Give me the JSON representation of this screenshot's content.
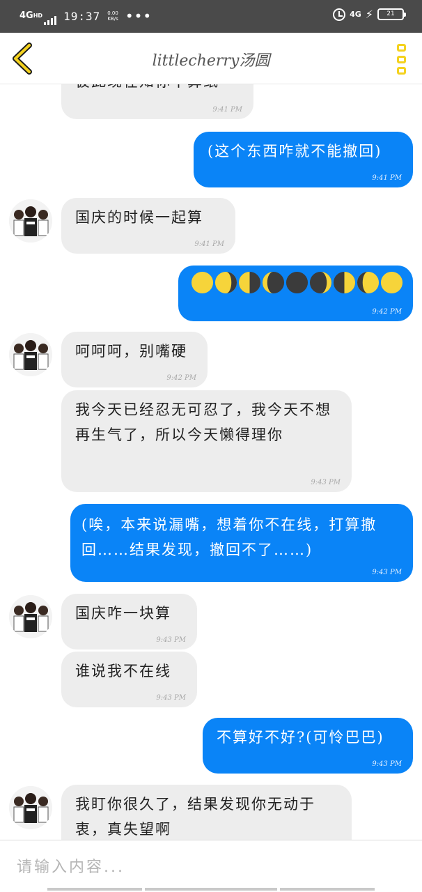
{
  "status_bar": {
    "network": "4G",
    "network_sup": "HD",
    "time": "19:37",
    "speed": "0.00\nKB/s",
    "dots": "•••",
    "right_network": "4G",
    "battery": "21"
  },
  "header": {
    "title": "littlecherry汤圆"
  },
  "messages": [
    {
      "text": "彼此现在知你不算纸",
      "time": "9:41 PM"
    },
    {
      "text": "(这个东西咋就不能撤回)",
      "time": "9:41 PM"
    },
    {
      "text": "国庆的时候一起算",
      "time": "9:41 PM"
    },
    {
      "text": "",
      "time": "9:42 PM"
    },
    {
      "text": "呵呵呵，别嘴硬",
      "time": "9:42 PM"
    },
    {
      "text": "我今天已经忍无可忍了，我今天不想再生气了，所以今天懒得理你",
      "time": "9:43 PM"
    },
    {
      "text": "(唉，本来说漏嘴，想着你不在线，打算撤回……结果发现，撤回不了……)",
      "time": "9:43 PM"
    },
    {
      "text": "国庆咋一块算",
      "time": "9:43 PM"
    },
    {
      "text": "谁说我不在线",
      "time": "9:43 PM"
    },
    {
      "text": "不算好不好?(可怜巴巴)",
      "time": "9:43 PM"
    },
    {
      "text": "我盯你很久了，结果发现你无动于衷，真失望啊",
      "time": ""
    }
  ],
  "moon_phases": [
    "full-moon",
    "waning-gibbous",
    "last-quarter",
    "waning-crescent",
    "new-moon",
    "waxing-crescent",
    "first-quarter",
    "waxing-gibbous",
    "full-moon"
  ],
  "input": {
    "placeholder": "请输入内容..."
  },
  "colors": {
    "outgoing_bubble": "#0a84f7",
    "incoming_bubble": "#ededed",
    "accent": "#f4d21f",
    "status_bar": "#4a4a4a"
  }
}
